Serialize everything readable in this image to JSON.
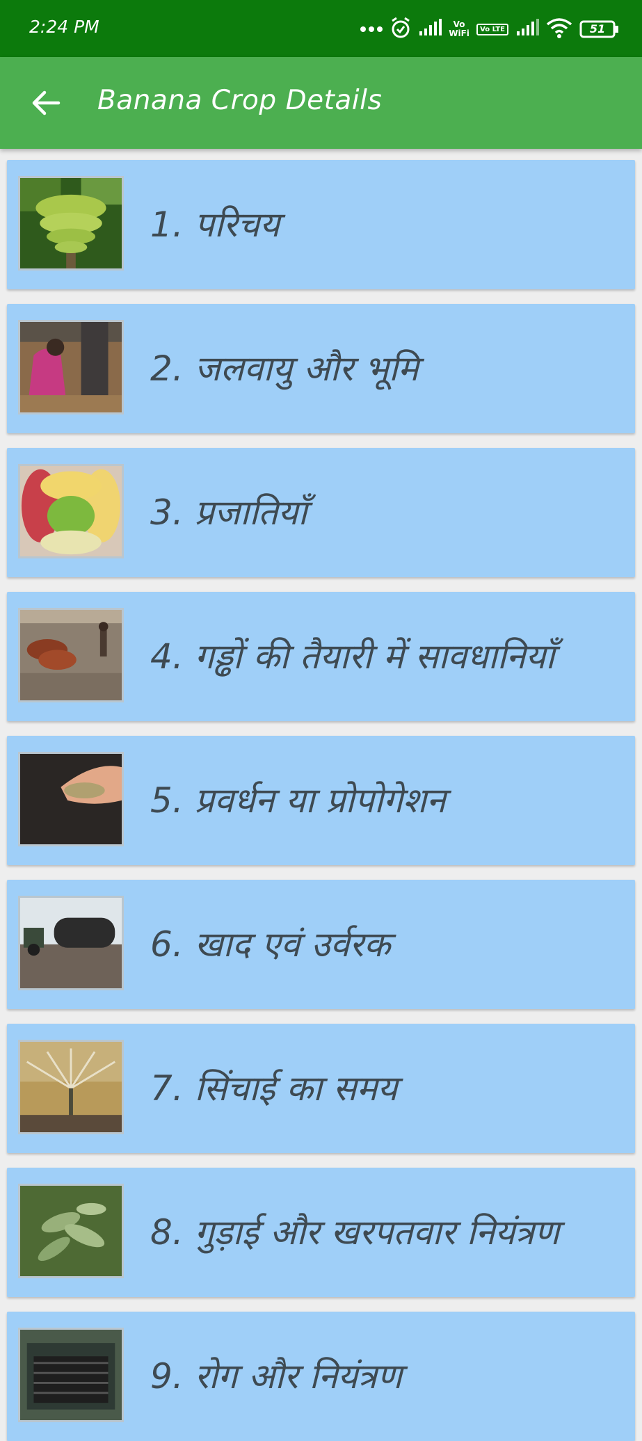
{
  "status_bar": {
    "time": "2:24 PM",
    "battery": "51",
    "vowifi": "Vo WiFi",
    "volte": "Vo LTE",
    "icons": [
      "more-dots-icon",
      "alarm-icon",
      "signal-icon",
      "vowifi-icon",
      "volte-icon",
      "signal-icon-2",
      "wifi-icon",
      "battery-icon"
    ]
  },
  "app_bar": {
    "title": "Banana Crop Details",
    "back_icon": "arrow-left-icon",
    "color": "#4caf50"
  },
  "list": {
    "card_color": "#9fcff8",
    "items": [
      {
        "label": "1. परिचय",
        "image": "banana-bunch"
      },
      {
        "label": "2. जलवायु और भूमि",
        "image": "farmer-planting"
      },
      {
        "label": "3. प्रजातियाँ",
        "image": "banana-varieties"
      },
      {
        "label": "4. गड्ढों की तैयारी में सावधानियाँ",
        "image": "ox-ploughing"
      },
      {
        "label": "5. प्रवर्धन या प्रोपोगेशन",
        "image": "seeds-in-hand"
      },
      {
        "label": "6. खाद एवं उर्वरक",
        "image": "tractor-field"
      },
      {
        "label": "7. सिंचाई का समय",
        "image": "sprinkler-irrigation"
      },
      {
        "label": "8. गुड़ाई और खरपतवार नियंत्रण",
        "image": "weeds-plant"
      },
      {
        "label": "9. रोग और नियंत्रण",
        "image": "sprayer-machine"
      }
    ]
  }
}
